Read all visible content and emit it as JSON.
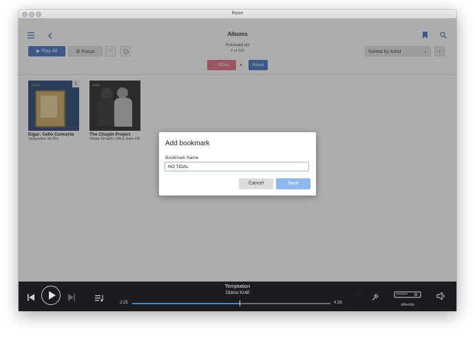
{
  "window": {
    "title": "Roon"
  },
  "header": {
    "title": "Albums",
    "focus_line1": "Focused on",
    "focus_line2": "2 of 310"
  },
  "toolbar": {
    "play_all_label": "Play All",
    "focus_label": "Focus",
    "sort_label": "Sorted by Artist"
  },
  "filter": {
    "chip_label": "TIDAL",
    "chip_prefix": "−",
    "reset_label": "Reset"
  },
  "albums": [
    {
      "title": "Elgar: Cello Concerto",
      "artist": "Jacqueline du Pré",
      "cover_text": "2",
      "cover_badge": "192/24"
    },
    {
      "title": "The Chopin Project",
      "artist": "Ólafur Arnalds / Alice Sara Ott",
      "cover_badge": "24/96"
    }
  ],
  "dialog": {
    "title": "Add bookmark",
    "field_label": "Bookmark Name",
    "field_value": "NO TIDAL",
    "cancel_label": "Cancel",
    "save_label": "Save"
  },
  "player": {
    "track": "Temptation",
    "artist": "Diana Krall",
    "elapsed": "2:25",
    "total": "4:28",
    "progress": 0.54,
    "zone": "uRendu"
  },
  "colors": {
    "accent": "#3a6fc0",
    "chip": "#e06a7c",
    "save": "#8bb8ee",
    "player_bg": "#1b1c1f"
  },
  "icons": [
    "hamburger-icon",
    "back-chevron-icon",
    "bookmark-icon",
    "search-icon",
    "play-icon",
    "focus-gear-icon",
    "heart-icon",
    "tag-icon",
    "chevron-down-icon",
    "sort-arrow-icon",
    "skip-back-icon",
    "skip-forward-icon",
    "queue-icon",
    "pin-icon",
    "zone-device-icon",
    "volume-icon"
  ]
}
